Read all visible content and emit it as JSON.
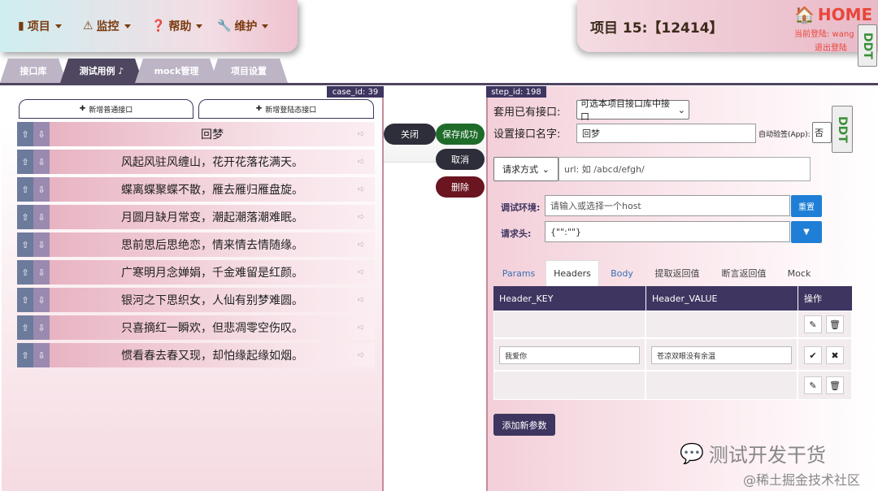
{
  "nav": {
    "items": [
      {
        "label": "项目",
        "icon": "book-icon"
      },
      {
        "label": "监控",
        "icon": "warning-icon"
      },
      {
        "label": "帮助",
        "icon": "question-icon"
      },
      {
        "label": "维护",
        "icon": "wrench-icon"
      }
    ]
  },
  "project": {
    "title": "项目 15:【12414】",
    "home_label": "HOME",
    "current_user": "当前登陆: wang",
    "logout": "退出登陆",
    "badge": "DDT"
  },
  "tabs": [
    {
      "label": "接口库",
      "active": false
    },
    {
      "label": "测试用例 ♪",
      "active": true
    },
    {
      "label": "mock管理",
      "active": false
    },
    {
      "label": "项目设置",
      "active": false
    }
  ],
  "left": {
    "case_id": "case_id: 39",
    "add_normal": "新增普通接口",
    "add_login": "新增登陆态接口",
    "steps": [
      "回梦",
      "风起风驻风缠山，花开花落花满天。",
      "蝶离蝶聚蝶不散，雁去雁归雁盘旋。",
      "月圆月缺月常变，潮起潮落潮难眠。",
      "思前思后思绝恋，情来情去情随缘。",
      "广寒明月念婵娟，千金难留是红颜。",
      "银河之下思织女，人仙有别梦难圆。",
      "只喜摘红一瞬欢，但悲凋零空伤叹。",
      "惯看春去春又现，却怕缘起缘如烟。"
    ]
  },
  "mid": {
    "close": "关闭",
    "save_ok": "保存成功",
    "cancel": "取消",
    "delete": "删除"
  },
  "right": {
    "step_id": "step_id: 198",
    "use_existing_label": "套用已有接口:",
    "use_existing_value": "可选本项目接口库中接口",
    "name_label": "设置接口名字:",
    "name_value": "回梦",
    "auto_verify_label": "自动验签(App):",
    "auto_verify_value": "否",
    "method_value": "请求方式",
    "url_placeholder": "url: 如 /abcd/efgh/",
    "env_label": "调试环境:",
    "env_placeholder": "请输入或选择一个host",
    "reset": "重置",
    "header_label": "请求头:",
    "header_value": "{\"\":\"\"}",
    "subtabs": [
      "Params",
      "Headers",
      "Body",
      "提取返回值",
      "断言返回值",
      "Mock"
    ],
    "table": {
      "headers": [
        "Header_KEY",
        "Header_VALUE",
        "操作"
      ],
      "rows": [
        {
          "key": "",
          "value": "",
          "editing": false
        },
        {
          "key": "我爱你",
          "value": "苍凉双眼没有余温",
          "editing": true
        },
        {
          "key": "",
          "value": "",
          "editing": false
        }
      ]
    },
    "add_param": "添加新参数"
  },
  "watermark": {
    "line1": "测试开发干货",
    "line2": "@稀土掘金技术社区"
  }
}
